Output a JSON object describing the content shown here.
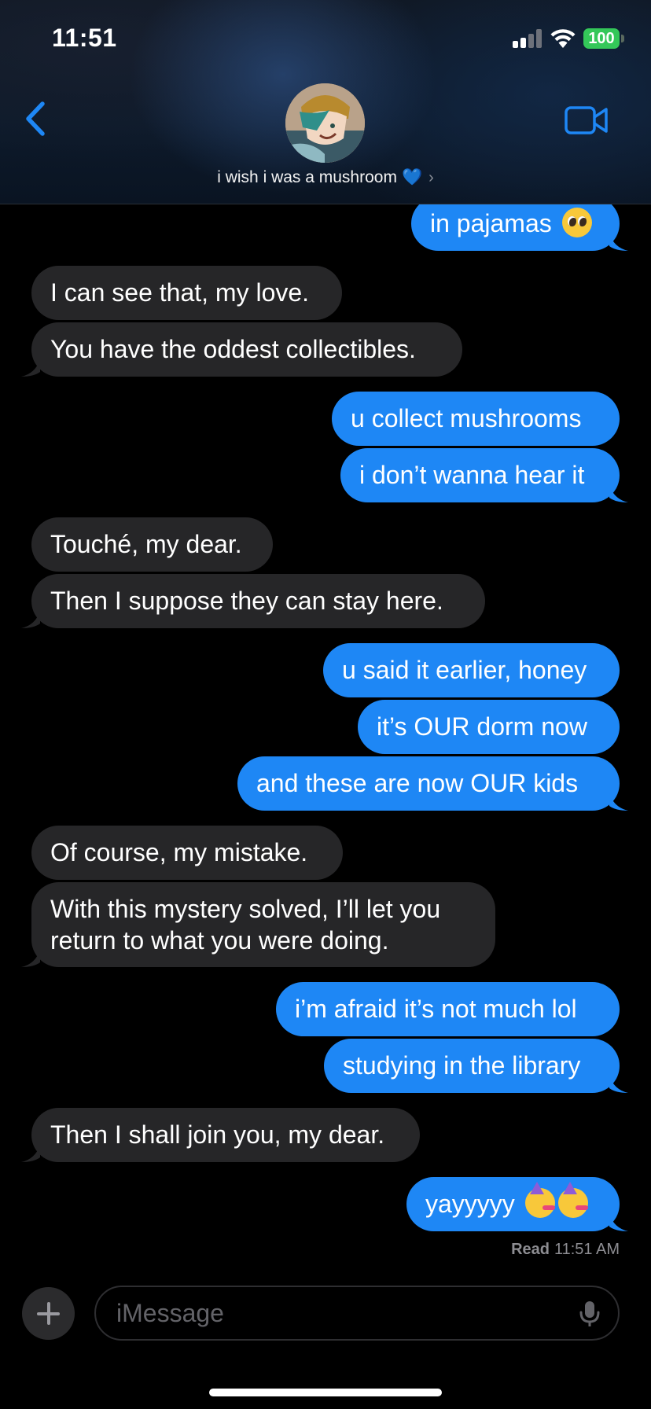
{
  "status_bar": {
    "time": "11:51",
    "battery": "100"
  },
  "header": {
    "contact_name": "i wish i was a mushroom",
    "heart": "💙",
    "chevron": "›",
    "back_icon": "chevron-left-icon",
    "call_icon": "video-camera-icon"
  },
  "messages": [
    {
      "dir": "out",
      "text": "in pajamas"
    },
    {
      "dir": "in",
      "text": "I can see that, my love."
    },
    {
      "dir": "in",
      "text": "You have the oddest collectibles."
    },
    {
      "dir": "out",
      "text": "u collect mushrooms"
    },
    {
      "dir": "out",
      "text": "i don’t wanna hear it"
    },
    {
      "dir": "in",
      "text": "Touché, my dear."
    },
    {
      "dir": "in",
      "text": "Then I suppose they can stay here."
    },
    {
      "dir": "out",
      "text": "u said it earlier, honey"
    },
    {
      "dir": "out",
      "text": "it’s OUR dorm now"
    },
    {
      "dir": "out",
      "text": "and these are now OUR kids"
    },
    {
      "dir": "in",
      "text": "Of course, my mistake."
    },
    {
      "dir": "in",
      "text": "With this mystery solved, I’ll let you return to what you were doing."
    },
    {
      "dir": "out",
      "text": "i’m afraid it’s not much lol"
    },
    {
      "dir": "out",
      "text": "studying in the library"
    },
    {
      "dir": "in",
      "text": "Then I shall join you, my dear."
    },
    {
      "dir": "out",
      "text": "yayyyyy"
    }
  ],
  "read_receipt": {
    "label": "Read",
    "time": "11:51 AM"
  },
  "composer": {
    "placeholder": "iMessage",
    "add_icon": "plus-icon",
    "mic_icon": "microphone-icon"
  },
  "colors": {
    "outgoing_bubble": "#1e87f5",
    "incoming_bubble": "#262628",
    "accent": "#1e87f5",
    "battery": "#34c759"
  }
}
